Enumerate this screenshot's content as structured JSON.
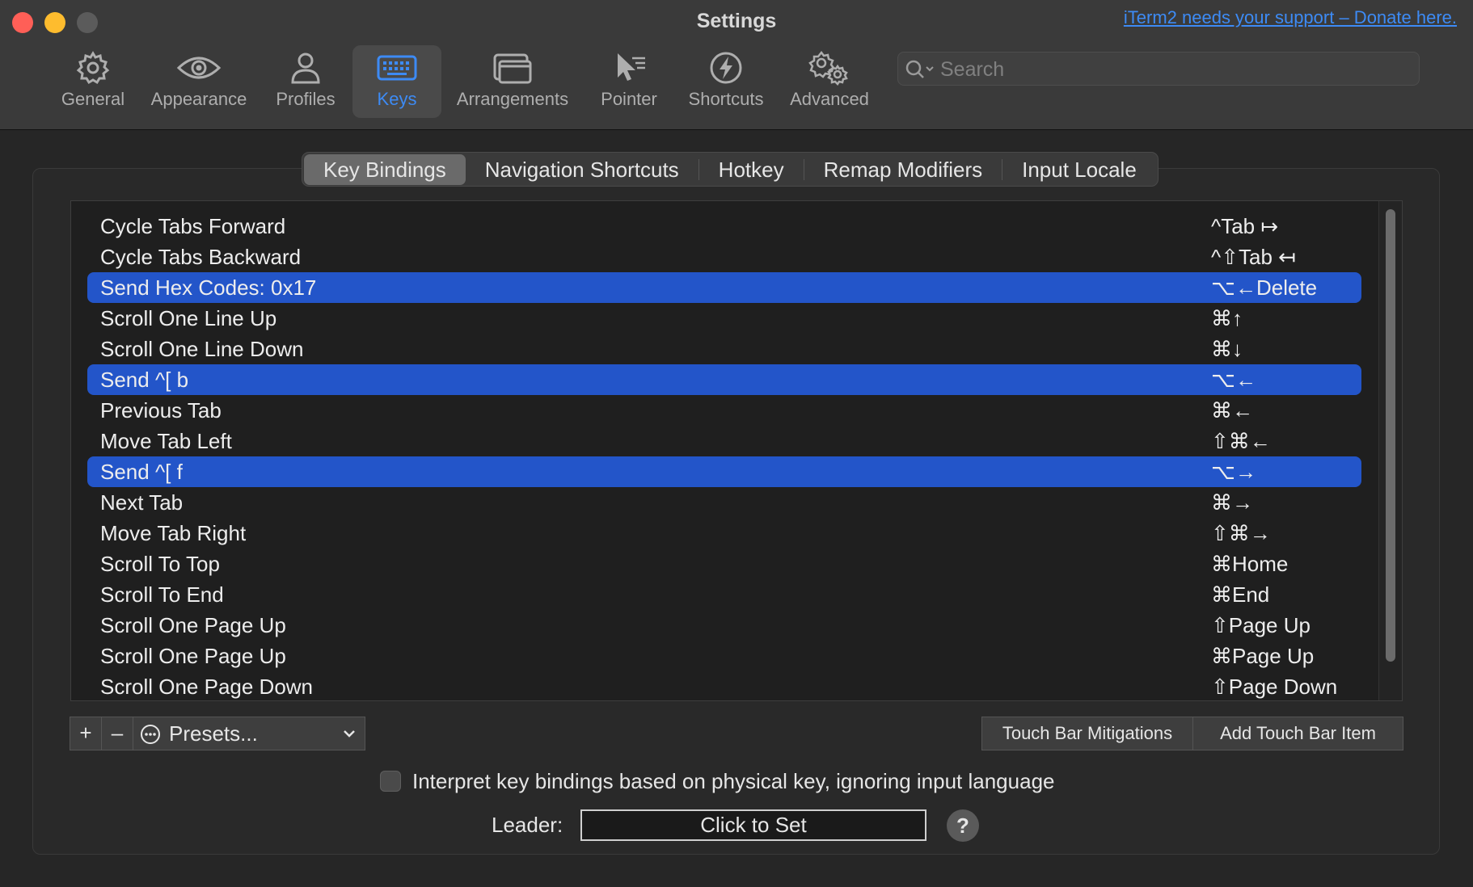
{
  "window": {
    "title": "Settings",
    "donate_link": "iTerm2 needs your support – Donate here."
  },
  "toolbar": {
    "items": [
      {
        "label": "General",
        "icon": "gear-icon"
      },
      {
        "label": "Appearance",
        "icon": "eye-icon"
      },
      {
        "label": "Profiles",
        "icon": "person-icon"
      },
      {
        "label": "Keys",
        "icon": "keyboard-icon",
        "active": true
      },
      {
        "label": "Arrangements",
        "icon": "windows-icon"
      },
      {
        "label": "Pointer",
        "icon": "pointer-icon"
      },
      {
        "label": "Shortcuts",
        "icon": "bolt-icon"
      },
      {
        "label": "Advanced",
        "icon": "gears-icon"
      }
    ],
    "search_placeholder": "Search"
  },
  "tabs": [
    "Key Bindings",
    "Navigation Shortcuts",
    "Hotkey",
    "Remap Modifiers",
    "Input Locale"
  ],
  "active_tab": "Key Bindings",
  "bindings": [
    {
      "action": "Cycle Tabs Forward",
      "combo": "^Tab ↦",
      "selected": false
    },
    {
      "action": "Cycle Tabs Backward",
      "combo": "^⇧Tab ↤",
      "selected": false
    },
    {
      "action": "Send Hex Codes: 0x17",
      "combo": "⌥←Delete",
      "selected": true
    },
    {
      "action": "Scroll One Line Up",
      "combo": "⌘↑",
      "selected": false
    },
    {
      "action": "Scroll One Line Down",
      "combo": "⌘↓",
      "selected": false
    },
    {
      "action": "Send ^[ b",
      "combo": "⌥←",
      "selected": true
    },
    {
      "action": "Previous Tab",
      "combo": "⌘←",
      "selected": false
    },
    {
      "action": "Move Tab Left",
      "combo": "⇧⌘←",
      "selected": false
    },
    {
      "action": "Send ^[ f",
      "combo": "⌥→",
      "selected": true
    },
    {
      "action": "Next Tab",
      "combo": "⌘→",
      "selected": false
    },
    {
      "action": "Move Tab Right",
      "combo": "⇧⌘→",
      "selected": false
    },
    {
      "action": "Scroll To Top",
      "combo": "⌘Home",
      "selected": false
    },
    {
      "action": "Scroll To End",
      "combo": "⌘End",
      "selected": false
    },
    {
      "action": "Scroll One Page Up",
      "combo": "⇧Page Up",
      "selected": false
    },
    {
      "action": "Scroll One Page Up",
      "combo": "⌘Page Up",
      "selected": false
    },
    {
      "action": "Scroll One Page Down",
      "combo": "⇧Page Down",
      "selected": false
    }
  ],
  "controls": {
    "add": "+",
    "remove": "–",
    "presets": "Presets...",
    "touch_bar_mitigations": "Touch Bar Mitigations",
    "add_touch_bar_item": "Add Touch Bar Item",
    "physical_key_checkbox": "Interpret key bindings based on physical key, ignoring input language",
    "leader_label": "Leader:",
    "leader_value": "Click to Set",
    "help": "?"
  },
  "colors": {
    "accent": "#3d8bf5",
    "selection": "#2355c9",
    "close": "#ff5f57",
    "minimize": "#febc2e"
  }
}
